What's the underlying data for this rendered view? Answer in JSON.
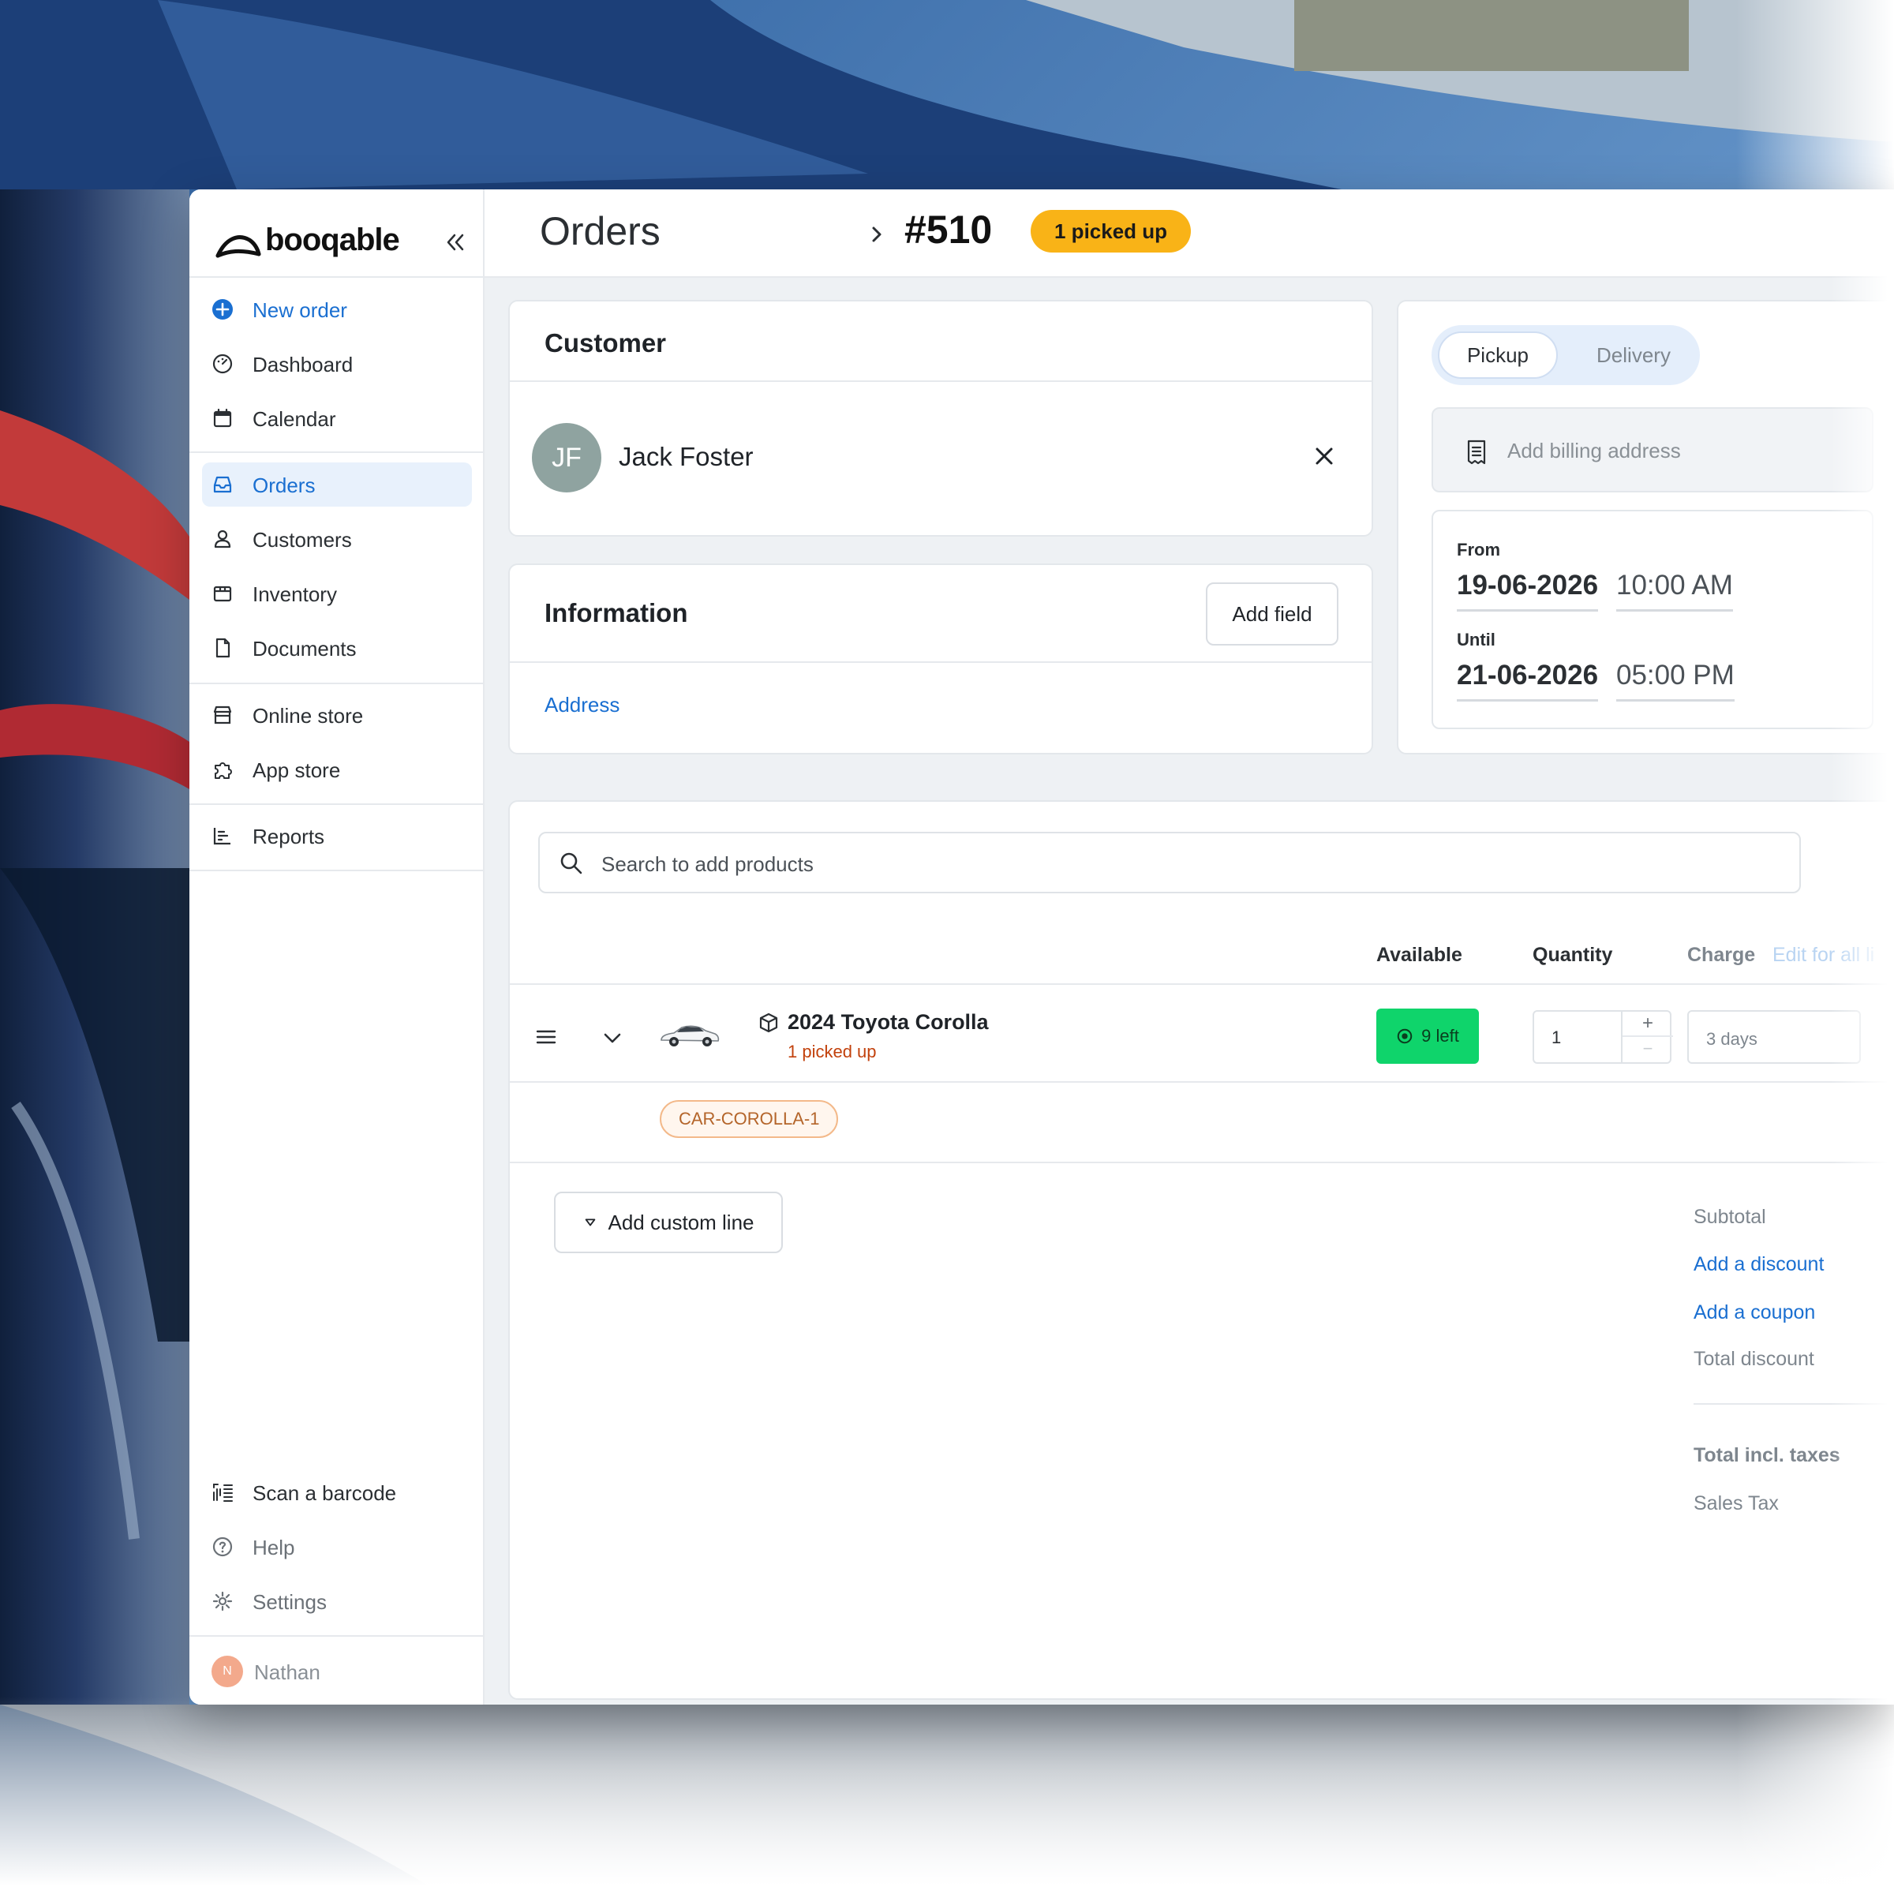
{
  "brand": {
    "name": "booqable"
  },
  "sidebar": {
    "primary_items": [
      {
        "label": "New order",
        "icon": "plus-circle-icon"
      },
      {
        "label": "Dashboard",
        "icon": "gauge-icon"
      },
      {
        "label": "Calendar",
        "icon": "calendar-icon"
      }
    ],
    "main_items": [
      {
        "label": "Orders",
        "icon": "inbox-icon",
        "active": true
      },
      {
        "label": "Customers",
        "icon": "person-icon"
      },
      {
        "label": "Inventory",
        "icon": "box-icon"
      },
      {
        "label": "Documents",
        "icon": "document-icon"
      }
    ],
    "store_items": [
      {
        "label": "Online store",
        "icon": "store-icon"
      },
      {
        "label": "App store",
        "icon": "puzzle-icon"
      }
    ],
    "report_items": [
      {
        "label": "Reports",
        "icon": "bar-chart-icon"
      }
    ],
    "footer_items": [
      {
        "label": "Scan a barcode",
        "icon": "barcode-icon"
      },
      {
        "label": "Help",
        "icon": "help-icon"
      },
      {
        "label": "Settings",
        "icon": "gear-icon"
      }
    ],
    "user": {
      "initial": "N",
      "name": "Nathan"
    }
  },
  "header": {
    "section": "Orders",
    "order_number": "#510",
    "status": "1 picked up",
    "status_color": "#f9b317"
  },
  "customer_card": {
    "title": "Customer",
    "initials": "JF",
    "name": "Jack Foster"
  },
  "information_card": {
    "title": "Information",
    "add_field_label": "Add field",
    "address_link": "Address"
  },
  "fulfillment": {
    "options": [
      "Pickup",
      "Delivery"
    ],
    "selected": "Pickup",
    "billing_placeholder": "Add billing address",
    "from_label": "From",
    "from_date": "19-06-2026",
    "from_time": "10:00 AM",
    "until_label": "Until",
    "until_date": "21-06-2026",
    "until_time": "05:00 PM"
  },
  "products": {
    "search_placeholder": "Search to add products",
    "columns": {
      "available": "Available",
      "quantity": "Quantity",
      "charge": "Charge",
      "edit_for_all": "Edit for all li"
    },
    "lines": [
      {
        "name": "2024 Toyota Corolla",
        "status": "1 picked up",
        "available": "9 left",
        "quantity": "1",
        "charge": "3 days",
        "sku": "CAR-COROLLA-1"
      }
    ],
    "add_custom_line": "Add custom line"
  },
  "summary": {
    "subtotal": "Subtotal",
    "add_discount": "Add a discount",
    "add_coupon": "Add a coupon",
    "total_discount": "Total discount",
    "total_incl_taxes": "Total incl. taxes",
    "sales_tax": "Sales Tax"
  },
  "colors": {
    "accent": "#1a6fd1",
    "available_badge": "#0fd46b",
    "sku_tag": "#f3b98a"
  }
}
